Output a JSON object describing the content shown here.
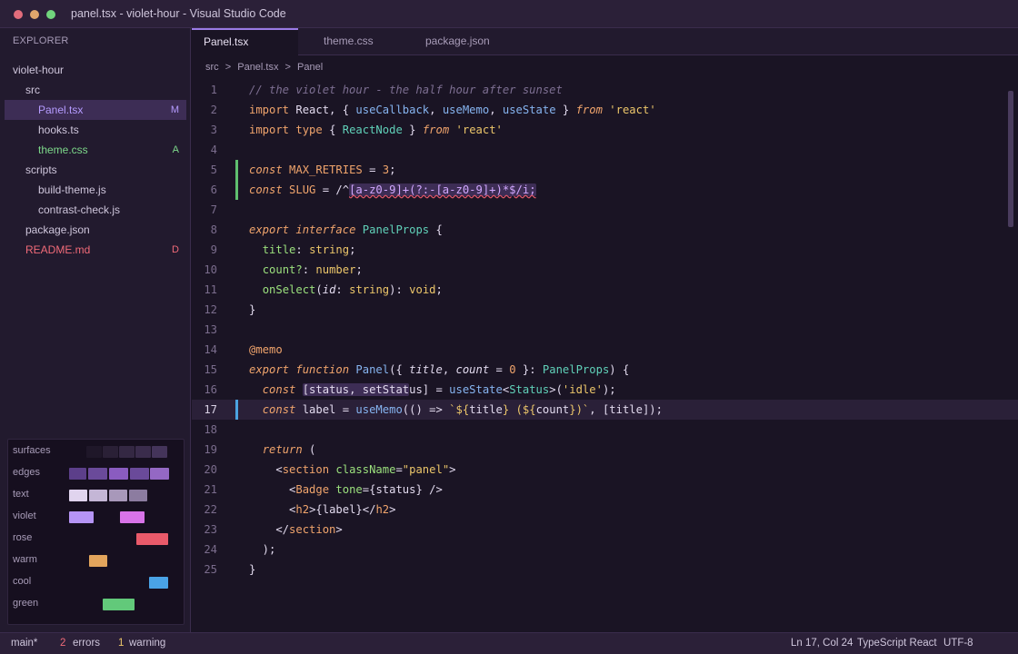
{
  "window": {
    "title": "panel.tsx - violet-hour - Visual Studio Code"
  },
  "sidebar": {
    "header": "EXPLORER",
    "tree": [
      {
        "label": "violet-hour",
        "indent": 0,
        "badge": "",
        "status": ""
      },
      {
        "label": "src",
        "indent": 1,
        "badge": "",
        "status": ""
      },
      {
        "label": "Panel.tsx",
        "indent": 2,
        "badge": "M",
        "status": "modified",
        "selected": true
      },
      {
        "label": "hooks.ts",
        "indent": 2,
        "badge": "",
        "status": ""
      },
      {
        "label": "theme.css",
        "indent": 2,
        "badge": "A",
        "status": "added"
      },
      {
        "label": "scripts",
        "indent": 1,
        "badge": "",
        "status": ""
      },
      {
        "label": "build-theme.js",
        "indent": 2,
        "badge": "",
        "status": ""
      },
      {
        "label": "contrast-check.js",
        "indent": 2,
        "badge": "",
        "status": ""
      },
      {
        "label": "package.json",
        "indent": 1,
        "badge": "",
        "status": ""
      },
      {
        "label": "README.md",
        "indent": 1,
        "badge": "D",
        "status": "deleted"
      }
    ]
  },
  "palette": {
    "rows": [
      {
        "label": "surfaces"
      },
      {
        "label": "edges"
      },
      {
        "label": "text"
      },
      {
        "label": "violet"
      },
      {
        "label": "rose"
      },
      {
        "label": "warm"
      },
      {
        "label": "cool"
      },
      {
        "label": "green"
      }
    ],
    "colors": {
      "surfaces": [
        "#1f1729",
        "#2a2036",
        "#342843",
        "#3a2c4c",
        "#44345a"
      ],
      "edges": [
        "#5c3f8a",
        "#6a4a9a",
        "#8a5cc0",
        "#6a4a9a",
        "#9468c4"
      ],
      "text": [
        "#e0d4ee",
        "#c4b6d6",
        "#a898ba",
        "#8c7ca0"
      ],
      "violet": [
        "#b594f5",
        "#d873e8"
      ],
      "rose": [
        "#e95a6a"
      ],
      "warm": [
        "#e2a45c"
      ],
      "cool": [
        "#4aa3e6"
      ],
      "green": [
        "#62c97a"
      ]
    }
  },
  "tabs": [
    {
      "label": "Panel.tsx",
      "active": true
    },
    {
      "label": "theme.css",
      "active": false
    },
    {
      "label": "package.json",
      "active": false
    }
  ],
  "breadcrumb": [
    "src",
    ">",
    "Panel.tsx",
    ">",
    "Panel"
  ],
  "editor": {
    "current_line": 17,
    "lines": [
      {
        "n": "1",
        "gutter": "",
        "tokens": [
          [
            "tk-comment",
            "// the violet hour - the half hour after sunset"
          ]
        ]
      },
      {
        "n": "2",
        "gutter": "",
        "tokens": [
          [
            "tk-kw",
            "import"
          ],
          [
            "tk-plain",
            " React, { "
          ],
          [
            "tk-fn",
            "useCallback"
          ],
          [
            "tk-plain",
            ", "
          ],
          [
            "tk-fn",
            "useMemo"
          ],
          [
            "tk-plain",
            ", "
          ],
          [
            "tk-fn",
            "useState"
          ],
          [
            "tk-plain",
            " } "
          ],
          [
            "tk-kwi",
            "from"
          ],
          [
            "tk-plain",
            " "
          ],
          [
            "tk-str",
            "'react'"
          ]
        ]
      },
      {
        "n": "3",
        "gutter": "",
        "tokens": [
          [
            "tk-kw",
            "import"
          ],
          [
            "tk-plain",
            " "
          ],
          [
            "tk-kw",
            "type"
          ],
          [
            "tk-plain",
            " { "
          ],
          [
            "tk-type",
            "ReactNode"
          ],
          [
            "tk-plain",
            " } "
          ],
          [
            "tk-kwi",
            "from"
          ],
          [
            "tk-plain",
            " "
          ],
          [
            "tk-str",
            "'react'"
          ]
        ]
      },
      {
        "n": "4",
        "gutter": "",
        "tokens": []
      },
      {
        "n": "5",
        "gutter": "green",
        "tokens": [
          [
            "tk-kwi",
            "const"
          ],
          [
            "tk-plain",
            " "
          ],
          [
            "tk-const",
            "MAX_RETRIES"
          ],
          [
            "tk-plain",
            " = "
          ],
          [
            "tk-num",
            "3"
          ],
          [
            "tk-plain",
            ";"
          ]
        ]
      },
      {
        "n": "6",
        "gutter": "green",
        "tokens": [
          [
            "tk-kwi",
            "const"
          ],
          [
            "tk-plain",
            " "
          ],
          [
            "tk-const",
            "SLUG"
          ],
          [
            "tk-plain",
            " = /^"
          ],
          [
            "tk-regex hl-box squiggle",
            "[a-z0-9]+(?:-[a-z0-9]+)*$/i;"
          ]
        ]
      },
      {
        "n": "7",
        "gutter": "",
        "tokens": []
      },
      {
        "n": "8",
        "gutter": "",
        "tokens": [
          [
            "tk-kwi",
            "export"
          ],
          [
            "tk-plain",
            " "
          ],
          [
            "tk-kwi",
            "interface"
          ],
          [
            "tk-plain",
            " "
          ],
          [
            "tk-type",
            "PanelProps"
          ],
          [
            "tk-plain",
            " {"
          ]
        ]
      },
      {
        "n": "9",
        "gutter": "",
        "tokens": [
          [
            "tk-plain",
            "  "
          ],
          [
            "tk-prop",
            "title"
          ],
          [
            "tk-plain",
            ": "
          ],
          [
            "tk-str",
            "string"
          ],
          [
            "tk-plain",
            ";"
          ]
        ]
      },
      {
        "n": "10",
        "gutter": "",
        "tokens": [
          [
            "tk-plain",
            "  "
          ],
          [
            "tk-prop",
            "count?"
          ],
          [
            "tk-plain",
            ": "
          ],
          [
            "tk-str",
            "number"
          ],
          [
            "tk-plain",
            ";"
          ]
        ]
      },
      {
        "n": "11",
        "gutter": "",
        "tokens": [
          [
            "tk-plain",
            "  "
          ],
          [
            "tk-prop",
            "onSelect"
          ],
          [
            "tk-plain",
            "("
          ],
          [
            "tk-param",
            "id"
          ],
          [
            "tk-plain",
            ": "
          ],
          [
            "tk-str",
            "string"
          ],
          [
            "tk-plain",
            "): "
          ],
          [
            "tk-str",
            "void"
          ],
          [
            "tk-plain",
            ";"
          ]
        ]
      },
      {
        "n": "12",
        "gutter": "",
        "tokens": [
          [
            "tk-plain",
            "}"
          ]
        ]
      },
      {
        "n": "13",
        "gutter": "",
        "tokens": []
      },
      {
        "n": "14",
        "gutter": "",
        "tokens": [
          [
            "tk-deco",
            "@memo"
          ]
        ]
      },
      {
        "n": "15",
        "gutter": "",
        "tokens": [
          [
            "tk-kwi",
            "export"
          ],
          [
            "tk-plain",
            " "
          ],
          [
            "tk-kwi",
            "function"
          ],
          [
            "tk-plain",
            " "
          ],
          [
            "tk-fn",
            "Panel"
          ],
          [
            "tk-plain",
            "({ "
          ],
          [
            "tk-param",
            "title"
          ],
          [
            "tk-plain",
            ", "
          ],
          [
            "tk-param",
            "count"
          ],
          [
            "tk-plain",
            " = "
          ],
          [
            "tk-num",
            "0"
          ],
          [
            "tk-plain",
            " }: "
          ],
          [
            "tk-type",
            "PanelProps"
          ],
          [
            "tk-plain",
            ") {"
          ]
        ]
      },
      {
        "n": "16",
        "gutter": "",
        "tokens": [
          [
            "tk-plain",
            "  "
          ],
          [
            "tk-kwi",
            "const"
          ],
          [
            "tk-plain",
            " "
          ],
          [
            "tk-plain hl-box",
            "[status, setStat"
          ],
          [
            "tk-plain",
            "us] = "
          ],
          [
            "tk-fn",
            "useState"
          ],
          [
            "tk-plain",
            "<"
          ],
          [
            "tk-type",
            "Status"
          ],
          [
            "tk-plain",
            ">("
          ],
          [
            "tk-str",
            "'idle'"
          ],
          [
            "tk-plain",
            ");"
          ]
        ]
      },
      {
        "n": "17",
        "gutter": "blue",
        "tokens": [
          [
            "tk-plain",
            "  "
          ],
          [
            "tk-kwi",
            "const"
          ],
          [
            "tk-plain",
            " label = "
          ],
          [
            "tk-fn",
            "useMemo"
          ],
          [
            "tk-plain",
            "(() => "
          ],
          [
            "tk-str",
            "`${"
          ],
          [
            "tk-plain",
            "title"
          ],
          [
            "tk-str",
            "} (${"
          ],
          [
            "tk-plain",
            "count"
          ],
          [
            "tk-str",
            "})`"
          ],
          [
            "tk-plain",
            ", [title]);"
          ]
        ]
      },
      {
        "n": "18",
        "gutter": "",
        "tokens": []
      },
      {
        "n": "19",
        "gutter": "",
        "tokens": [
          [
            "tk-plain",
            "  "
          ],
          [
            "tk-kwi",
            "return"
          ],
          [
            "tk-plain",
            " ("
          ]
        ]
      },
      {
        "n": "20",
        "gutter": "",
        "tokens": [
          [
            "tk-plain",
            "    <"
          ],
          [
            "tk-tag",
            "section"
          ],
          [
            "tk-plain",
            " "
          ],
          [
            "tk-attr",
            "className"
          ],
          [
            "tk-plain",
            "="
          ],
          [
            "tk-str",
            "\"panel\""
          ],
          [
            "tk-plain",
            ">"
          ]
        ]
      },
      {
        "n": "21",
        "gutter": "",
        "tokens": [
          [
            "tk-plain",
            "      <"
          ],
          [
            "tk-tag",
            "Badge"
          ],
          [
            "tk-plain",
            " "
          ],
          [
            "tk-attr",
            "tone"
          ],
          [
            "tk-plain",
            "={status} />"
          ]
        ]
      },
      {
        "n": "22",
        "gutter": "",
        "tokens": [
          [
            "tk-plain",
            "      <"
          ],
          [
            "tk-tag",
            "h2"
          ],
          [
            "tk-plain",
            ">{label}</"
          ],
          [
            "tk-tag",
            "h2"
          ],
          [
            "tk-plain",
            ">"
          ]
        ]
      },
      {
        "n": "23",
        "gutter": "",
        "tokens": [
          [
            "tk-plain",
            "    </"
          ],
          [
            "tk-tag",
            "section"
          ],
          [
            "tk-plain",
            ">"
          ]
        ]
      },
      {
        "n": "24",
        "gutter": "",
        "tokens": [
          [
            "tk-plain",
            "  );"
          ]
        ]
      },
      {
        "n": "25",
        "gutter": "",
        "tokens": [
          [
            "tk-plain",
            "}"
          ]
        ]
      }
    ]
  },
  "statusbar": {
    "branch": "main*",
    "errors_count": "2",
    "errors_label": "errors",
    "warnings_count": "1",
    "warnings_label": "warning",
    "position": "Ln 17, Col 24",
    "language": "TypeScript React",
    "encoding": "UTF-8"
  }
}
